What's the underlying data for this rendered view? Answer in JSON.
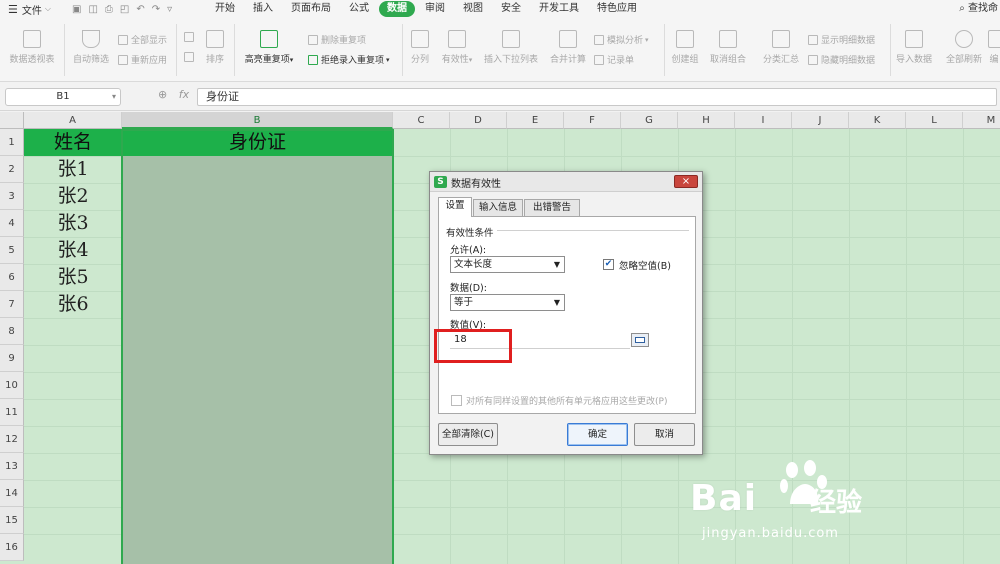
{
  "menubar": {
    "file_label": "文件",
    "tabs": [
      {
        "label": "开始"
      },
      {
        "label": "插入"
      },
      {
        "label": "页面布局"
      },
      {
        "label": "公式"
      },
      {
        "label": "数据"
      },
      {
        "label": "审阅"
      },
      {
        "label": "视图"
      },
      {
        "label": "安全"
      },
      {
        "label": "开发工具"
      },
      {
        "label": "特色应用"
      }
    ],
    "active_tab": "数据",
    "search_label": "查找命"
  },
  "ribbon": {
    "pivot": "数据透视表",
    "autofilter": "自动筛选",
    "show_all": "全部显示",
    "reapply": "重新应用",
    "sort": "排序",
    "highlight_dup": "高亮重复项",
    "remove_dup": "删除重复项",
    "reject_dup": "拒绝录入重复项",
    "split": "分列",
    "validity": "有效性",
    "dropdown_list": "插入下拉列表",
    "merge_calc": "合并计算",
    "what_if": "模拟分析",
    "record_sheet": "记录单",
    "group": "创建组",
    "ungroup": "取消组合",
    "subtotal": "分类汇总",
    "show_detail": "显示明细数据",
    "hide_detail": "隐藏明细数据",
    "import": "导入数据",
    "refresh_all": "全部刷新",
    "edit_link": "编"
  },
  "formula_bar": {
    "cell_ref": "B1",
    "fx": "fx",
    "value": "身份证"
  },
  "grid": {
    "columns": [
      "A",
      "B",
      "C",
      "D",
      "E",
      "F",
      "G",
      "H",
      "I",
      "J",
      "K",
      "L",
      "M"
    ],
    "rows": [
      "1",
      "2",
      "3",
      "4",
      "5",
      "6",
      "7",
      "8",
      "9",
      "10",
      "11",
      "12",
      "13",
      "14",
      "15",
      "16"
    ],
    "header_a": "姓名",
    "header_b": "身份证",
    "names": [
      "张1",
      "张2",
      "张3",
      "张4",
      "张5",
      "张6"
    ]
  },
  "dialog": {
    "title": "数据有效性",
    "close": "×",
    "tabs": [
      "设置",
      "输入信息",
      "出错警告"
    ],
    "section": "有效性条件",
    "allow_label": "允许(A):",
    "allow_value": "文本长度",
    "ignore_blank": "忽略空值(B)",
    "data_label": "数据(D):",
    "data_value": "等于",
    "value_label": "数值(V):",
    "value": "18",
    "apply_all": "对所有同样设置的其他所有单元格应用这些更改(P)",
    "clear_all": "全部清除(C)",
    "ok": "确定",
    "cancel": "取消"
  },
  "watermark": {
    "brand": "Bai",
    "brand_cn": "经验",
    "url": "jingyan.baidu.com"
  },
  "colors": {
    "accent": "#2fa94f",
    "header_fill": "#1db04a",
    "sheet_bg": "#cde8cf",
    "selection_fill": "#a6c0a8",
    "highlight_box": "#e01f1f"
  }
}
